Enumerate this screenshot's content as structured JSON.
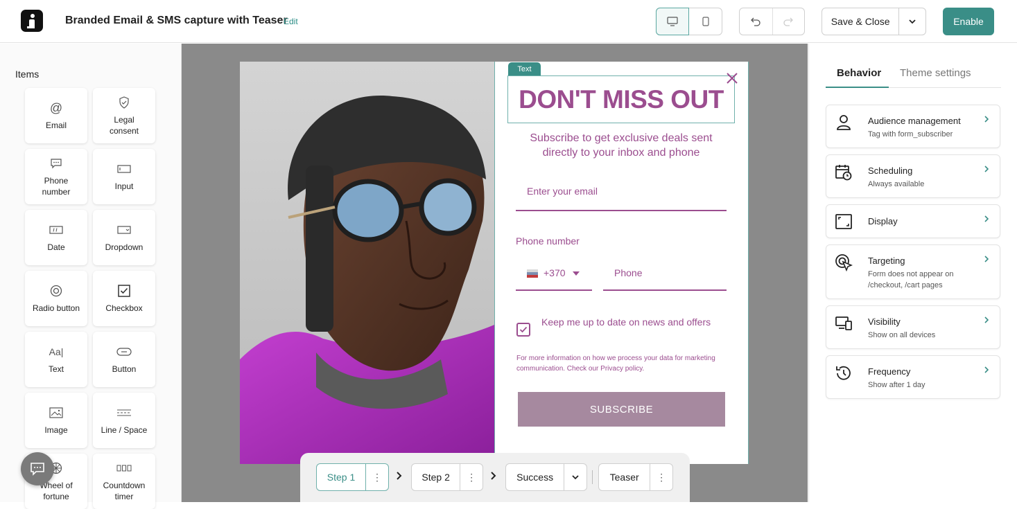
{
  "header": {
    "title": "Branded Email & SMS capture with Teaser",
    "edit_label": "Edit",
    "save_label": "Save & Close",
    "enable_label": "Enable"
  },
  "items_panel": {
    "heading": "Items",
    "items": [
      {
        "label": "Email",
        "icon": "at-icon"
      },
      {
        "label": "Legal consent",
        "icon": "shield-check-icon"
      },
      {
        "label": "Phone number",
        "icon": "chat-dots-icon"
      },
      {
        "label": "Input",
        "icon": "input-box-icon"
      },
      {
        "label": "Date",
        "icon": "date-field-icon"
      },
      {
        "label": "Dropdown",
        "icon": "dropdown-icon"
      },
      {
        "label": "Radio button",
        "icon": "radio-icon"
      },
      {
        "label": "Checkbox",
        "icon": "checkbox-icon"
      },
      {
        "label": "Text",
        "icon": "text-icon"
      },
      {
        "label": "Button",
        "icon": "button-icon"
      },
      {
        "label": "Image",
        "icon": "image-icon"
      },
      {
        "label": "Line / Space",
        "icon": "line-space-icon"
      },
      {
        "label": "Wheel of fortune",
        "icon": "wheel-icon"
      },
      {
        "label": "Countdown timer",
        "icon": "countdown-icon"
      }
    ]
  },
  "form": {
    "text_tag": "Text",
    "headline": "DON'T MISS OUT",
    "subtitle": "Subscribe to get exclusive deals sent directly to your inbox and phone",
    "email_placeholder": "Enter your email",
    "phone_label": "Phone number",
    "country_code": "+370",
    "phone_placeholder": "Phone",
    "checkbox_label": "Keep me up to date on news and offers",
    "privacy_text": "For more information on how we process your data for marketing communication. Check our Privacy policy.",
    "subscribe_label": "SUBSCRIBE",
    "accent_color": "#9b4d8f",
    "button_color": "#a6899f"
  },
  "steps": [
    {
      "label": "Step 1",
      "active": true
    },
    {
      "label": "Step 2",
      "active": false
    },
    {
      "label": "Success",
      "active": false
    },
    {
      "label": "Teaser",
      "active": false
    }
  ],
  "behavior": {
    "tabs": [
      "Behavior",
      "Theme settings"
    ],
    "cards": [
      {
        "title": "Audience management",
        "subtitle": "Tag with form_subscriber",
        "icon": "person-icon"
      },
      {
        "title": "Scheduling",
        "subtitle": "Always available",
        "icon": "calendar-clock-icon"
      },
      {
        "title": "Display",
        "subtitle": "",
        "icon": "display-frame-icon"
      },
      {
        "title": "Targeting",
        "subtitle": "Form does not appear on /checkout, /cart pages",
        "icon": "target-cursor-icon"
      },
      {
        "title": "Visibility",
        "subtitle": "Show on all devices",
        "icon": "devices-icon"
      },
      {
        "title": "Frequency",
        "subtitle": "Show after 1 day",
        "icon": "history-icon"
      }
    ]
  },
  "colors": {
    "brand": "#3a8e87",
    "canvas_bg": "#8a8a8a"
  }
}
